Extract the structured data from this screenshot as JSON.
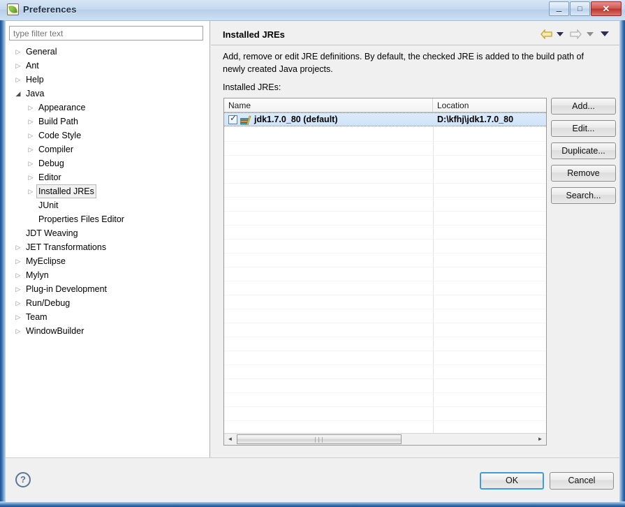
{
  "window": {
    "title": "Preferences",
    "icon": "leaf-icon",
    "minimize_label": "–",
    "maximize_label": "□",
    "close_label": "✕"
  },
  "sidebar": {
    "filter": {
      "value": "",
      "placeholder": "type filter text"
    },
    "items": [
      {
        "label": "General",
        "indent": 0,
        "arrow": "collapsed",
        "selected": false
      },
      {
        "label": "Ant",
        "indent": 0,
        "arrow": "collapsed",
        "selected": false
      },
      {
        "label": "Help",
        "indent": 0,
        "arrow": "collapsed",
        "selected": false
      },
      {
        "label": "Java",
        "indent": 0,
        "arrow": "expanded",
        "selected": false
      },
      {
        "label": "Appearance",
        "indent": 1,
        "arrow": "collapsed",
        "selected": false
      },
      {
        "label": "Build Path",
        "indent": 1,
        "arrow": "collapsed",
        "selected": false
      },
      {
        "label": "Code Style",
        "indent": 1,
        "arrow": "collapsed",
        "selected": false
      },
      {
        "label": "Compiler",
        "indent": 1,
        "arrow": "collapsed",
        "selected": false
      },
      {
        "label": "Debug",
        "indent": 1,
        "arrow": "collapsed",
        "selected": false
      },
      {
        "label": "Editor",
        "indent": 1,
        "arrow": "collapsed",
        "selected": false
      },
      {
        "label": "Installed JREs",
        "indent": 1,
        "arrow": "collapsed",
        "selected": true
      },
      {
        "label": "JUnit",
        "indent": 1,
        "arrow": "none",
        "selected": false
      },
      {
        "label": "Properties Files Editor",
        "indent": 1,
        "arrow": "none",
        "selected": false
      },
      {
        "label": "JDT Weaving",
        "indent": 0,
        "arrow": "none",
        "selected": false
      },
      {
        "label": "JET Transformations",
        "indent": 0,
        "arrow": "collapsed",
        "selected": false
      },
      {
        "label": "MyEclipse",
        "indent": 0,
        "arrow": "collapsed",
        "selected": false
      },
      {
        "label": "Mylyn",
        "indent": 0,
        "arrow": "collapsed",
        "selected": false
      },
      {
        "label": "Plug-in Development",
        "indent": 0,
        "arrow": "collapsed",
        "selected": false
      },
      {
        "label": "Run/Debug",
        "indent": 0,
        "arrow": "collapsed",
        "selected": false
      },
      {
        "label": "Team",
        "indent": 0,
        "arrow": "collapsed",
        "selected": false
      },
      {
        "label": "WindowBuilder",
        "indent": 0,
        "arrow": "collapsed",
        "selected": false
      }
    ]
  },
  "page": {
    "title": "Installed JREs",
    "description": "Add, remove or edit JRE definitions. By default, the checked JRE is added to the build path of newly created Java projects.",
    "list_label": "Installed JREs:",
    "nav": {
      "back_icon": "back-arrow-icon",
      "back_dropdown_icon": "caret-down-icon",
      "forward_icon": "forward-arrow-icon",
      "forward_dropdown_icon": "caret-down-icon",
      "menu_icon": "caret-down-icon"
    },
    "table": {
      "columns": [
        "Name",
        "Location"
      ],
      "rows": [
        {
          "checked": true,
          "icon": "jre-library-icon",
          "name": "jdk1.7.0_80 (default)",
          "location": "D:\\kfhj\\jdk1.7.0_80",
          "selected": true
        }
      ],
      "scrollbar": {
        "left_arrow": "◄",
        "right_arrow": "►",
        "grip": "∣∣∣"
      }
    },
    "buttons": [
      {
        "label": "Add...",
        "enabled": true
      },
      {
        "label": "Edit...",
        "enabled": true
      },
      {
        "label": "Duplicate...",
        "enabled": true
      },
      {
        "label": "Remove",
        "enabled": true
      },
      {
        "label": "Search...",
        "enabled": true
      }
    ]
  },
  "footer": {
    "help_icon": "?",
    "ok_label": "OK",
    "cancel_label": "Cancel"
  },
  "colors": {
    "selection_blue": "#cfe3f9",
    "focus_blue": "#3c9ddb",
    "window_frame": "#2b5f9e",
    "title_close_red": "#b8352e"
  }
}
